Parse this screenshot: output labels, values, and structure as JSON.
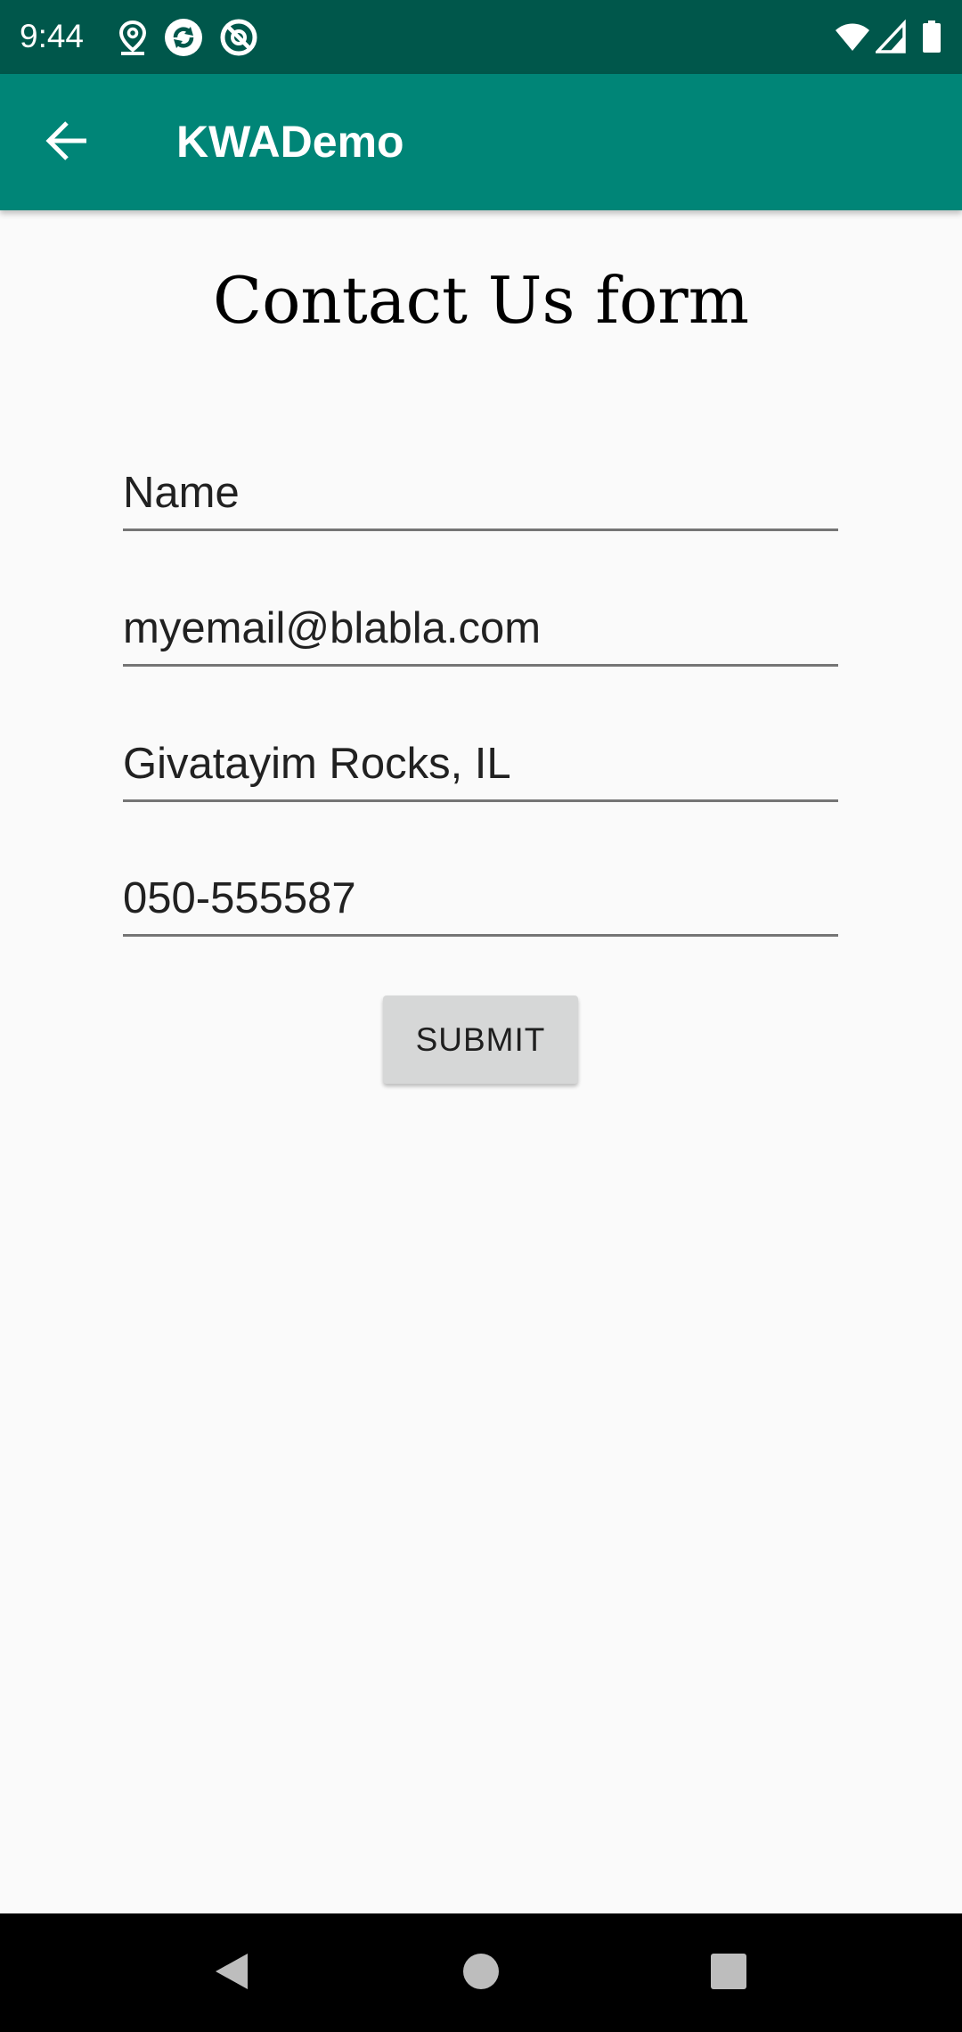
{
  "status_bar": {
    "time": "9:44",
    "icons_left": [
      "location-icon",
      "sync-icon",
      "data-saver-icon"
    ],
    "icons_right": [
      "wifi-icon",
      "cell-signal-icon",
      "battery-icon"
    ],
    "color": "#00574b"
  },
  "app_bar": {
    "title": "KWADemo",
    "back_icon": "arrow-back-icon",
    "color": "#008577"
  },
  "form": {
    "title": "Contact Us form",
    "name": {
      "placeholder": "Name",
      "value": ""
    },
    "email": {
      "value": "myemail@blabla.com"
    },
    "address": {
      "value": "Givatayim Rocks, IL"
    },
    "phone": {
      "value": "050-555587"
    },
    "submit_label": "SUBMIT"
  },
  "nav_bar": {
    "buttons": [
      "back-triangle-icon",
      "home-circle-icon",
      "recents-square-icon"
    ]
  }
}
